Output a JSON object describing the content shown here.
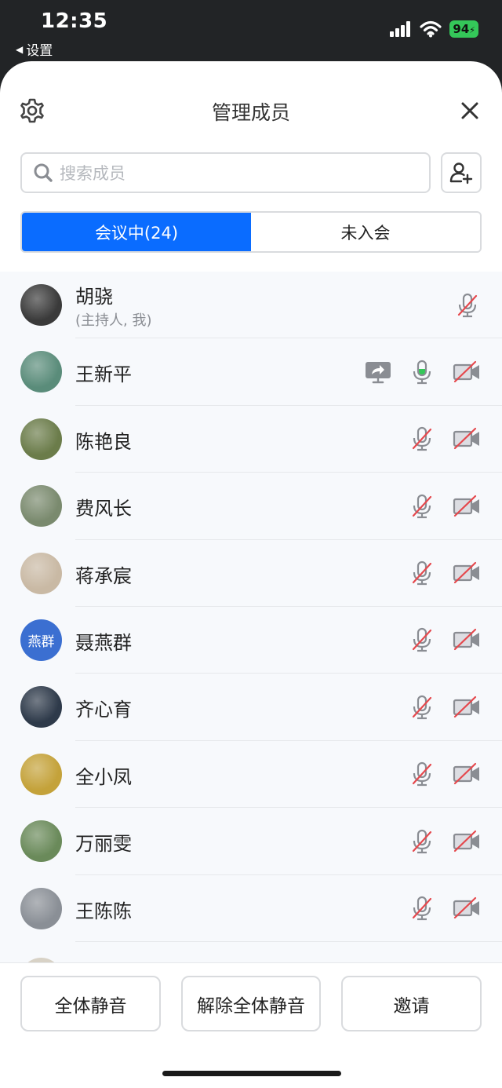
{
  "status_bar": {
    "time": "12:35",
    "back_label": "设置",
    "battery": "94"
  },
  "header": {
    "title": "管理成员"
  },
  "search": {
    "placeholder": "搜索成员"
  },
  "tabs": [
    {
      "label": "会议中(24)",
      "active": true
    },
    {
      "label": "未入会",
      "active": false
    }
  ],
  "participants": [
    {
      "name": "胡骁",
      "subtitle": "(主持人, 我)",
      "avatar": "photo",
      "avatar_color": "#3a3a3a",
      "sharing": false,
      "mic": "muted",
      "camera": null
    },
    {
      "name": "王新平",
      "avatar": "photo",
      "avatar_color": "#5a8c7a",
      "sharing": true,
      "mic": "active",
      "camera": "off"
    },
    {
      "name": "陈艳良",
      "avatar": "photo",
      "avatar_color": "#6b7c4a",
      "sharing": false,
      "mic": "muted",
      "camera": "off"
    },
    {
      "name": "费风长",
      "avatar": "photo",
      "avatar_color": "#7a8a6e",
      "sharing": false,
      "mic": "muted",
      "camera": "off"
    },
    {
      "name": "蒋承宸",
      "avatar": "photo",
      "avatar_color": "#c9b9a4",
      "sharing": false,
      "mic": "muted",
      "camera": "off"
    },
    {
      "name": "聂燕群",
      "avatar": "text",
      "avatar_text": "燕群",
      "avatar_color": "#3b6fd1",
      "sharing": false,
      "mic": "muted",
      "camera": "off"
    },
    {
      "name": "齐心育",
      "avatar": "photo",
      "avatar_color": "#2e3a4a",
      "sharing": false,
      "mic": "muted",
      "camera": "off"
    },
    {
      "name": "全小凤",
      "avatar": "photo",
      "avatar_color": "#c4a23a",
      "sharing": false,
      "mic": "muted",
      "camera": "off"
    },
    {
      "name": "万丽雯",
      "avatar": "photo",
      "avatar_color": "#6a8a5a",
      "sharing": false,
      "mic": "muted",
      "camera": "off"
    },
    {
      "name": "王陈陈",
      "avatar": "photo",
      "avatar_color": "#8a8f96",
      "sharing": false,
      "mic": "muted",
      "camera": "off"
    }
  ],
  "footer": {
    "mute_all": "全体静音",
    "unmute_all": "解除全体静音",
    "invite": "邀请"
  },
  "colors": {
    "accent": "#0a6cff",
    "mic_active": "#34c759",
    "muted_slash": "#e5484d",
    "icon_gray": "#8a8d93"
  }
}
